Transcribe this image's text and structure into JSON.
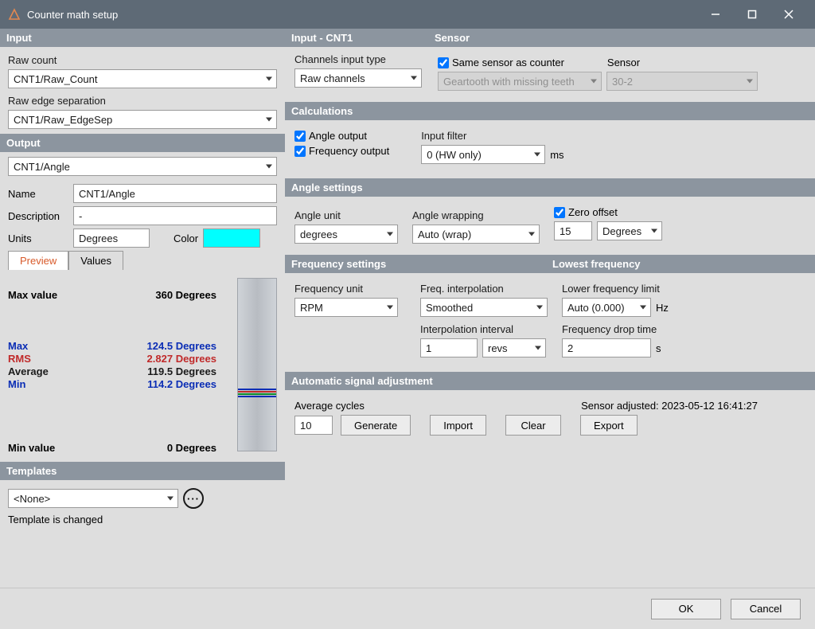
{
  "window": {
    "title": "Counter math setup"
  },
  "left": {
    "input_header": "Input",
    "raw_count_label": "Raw count",
    "raw_count_value": "CNT1/Raw_Count",
    "raw_edge_label": "Raw edge separation",
    "raw_edge_value": "CNT1/Raw_EdgeSep",
    "output_header": "Output",
    "output_channel": "CNT1/Angle",
    "name_label": "Name",
    "name_value": "CNT1/Angle",
    "desc_label": "Description",
    "desc_value": "-",
    "units_label": "Units",
    "units_value": "Degrees",
    "color_label": "Color",
    "tabs": {
      "preview": "Preview",
      "values": "Values"
    },
    "preview": {
      "max_value_label": "Max value",
      "max_value": "360 Degrees",
      "min_value_label": "Min value",
      "min_value": "0 Degrees",
      "stats": [
        {
          "k": "Max",
          "v": "124.5 Degrees"
        },
        {
          "k": "RMS",
          "v": "2.827 Degrees"
        },
        {
          "k": "Average",
          "v": "119.5 Degrees"
        },
        {
          "k": "Min",
          "v": "114.2 Degrees"
        }
      ]
    },
    "templates_header": "Templates",
    "template_value": "<None>",
    "template_status": "Template is changed"
  },
  "right": {
    "input_cnt_header": "Input - CNT1",
    "sensor_header": "Sensor",
    "channels_input_label": "Channels input type",
    "channels_input_value": "Raw channels",
    "same_sensor_label": "Same sensor as counter",
    "sensor_label": "Sensor",
    "sensor_type_value": "Geartooth with missing teeth",
    "sensor_model_value": "30-2",
    "calc_header": "Calculations",
    "angle_out_label": "Angle output",
    "freq_out_label": "Frequency output",
    "input_filter_label": "Input filter",
    "input_filter_value": "0 (HW only)",
    "input_filter_unit": "ms",
    "angle_settings_header": "Angle settings",
    "angle_unit_label": "Angle unit",
    "angle_unit_value": "degrees",
    "angle_wrap_label": "Angle wrapping",
    "angle_wrap_value": "Auto (wrap)",
    "zero_offset_label": "Zero offset",
    "zero_offset_value": "15",
    "zero_offset_unit": "Degrees",
    "freq_settings_header": "Frequency settings",
    "lowest_freq_header": "Lowest frequency",
    "freq_unit_label": "Frequency unit",
    "freq_unit_value": "RPM",
    "freq_interp_label": "Freq. interpolation",
    "freq_interp_value": "Smoothed",
    "interp_interval_label": "Interpolation interval",
    "interp_interval_value": "1",
    "interp_interval_unit": "revs",
    "lower_freq_label": "Lower frequency limit",
    "lower_freq_value": "Auto (0.000)",
    "lower_freq_unit": "Hz",
    "freq_drop_label": "Frequency drop time",
    "freq_drop_value": "2",
    "freq_drop_unit": "s",
    "auto_adj_header": "Automatic signal adjustment",
    "avg_cycles_label": "Average cycles",
    "avg_cycles_value": "10",
    "generate_btn": "Generate",
    "import_btn": "Import",
    "clear_btn": "Clear",
    "export_btn": "Export",
    "sensor_adjusted_label": "Sensor adjusted: 2023-05-12 16:41:27"
  },
  "footer": {
    "ok": "OK",
    "cancel": "Cancel"
  }
}
